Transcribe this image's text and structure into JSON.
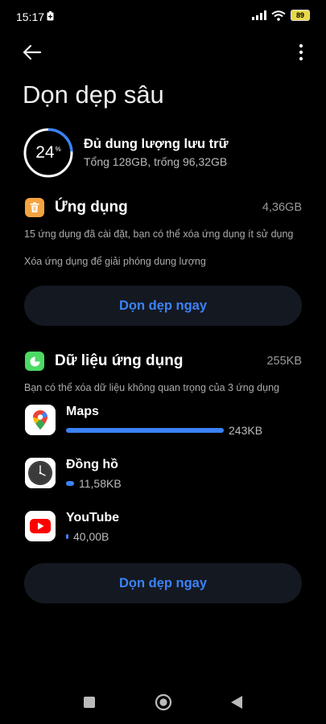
{
  "status": {
    "time": "15:17",
    "battery": "89"
  },
  "header": {
    "title": "Dọn dẹp sâu"
  },
  "storage": {
    "percent": "24",
    "percent_sign": "%",
    "percent_value": 24,
    "title": "Đủ dung lượng lưu trữ",
    "subtitle": "Tổng 128GB, trống 96,32GB",
    "ring_color": "#3b82f6"
  },
  "apps_section": {
    "title": "Ứng dụng",
    "size": "4,36GB",
    "desc1": "15 ứng dụng đã cài đặt, bạn có thể xóa ứng dụng ít sử dụng",
    "desc2": "Xóa ứng dụng để giải phóng dung lượng",
    "button": "Dọn dẹp ngay",
    "icon_color": "#f4a340"
  },
  "data_section": {
    "title": "Dữ liệu ứng dụng",
    "size": "255KB",
    "desc": "Bạn có thể xóa dữ liệu không quan trọng của 3 ứng dụng",
    "button": "Dọn dẹp ngay",
    "icon_color": "#4cd964",
    "apps": [
      {
        "name": "Maps",
        "size": "243KB",
        "fraction": 1.0,
        "icon": "google-maps-icon"
      },
      {
        "name": "Đồng hồ",
        "size": "11,58KB",
        "fraction": 0.05,
        "icon": "clock-icon"
      },
      {
        "name": "YouTube",
        "size": "40,00B",
        "fraction": 0.01,
        "icon": "youtube-icon"
      }
    ]
  },
  "accent_color": "#3b82f6"
}
